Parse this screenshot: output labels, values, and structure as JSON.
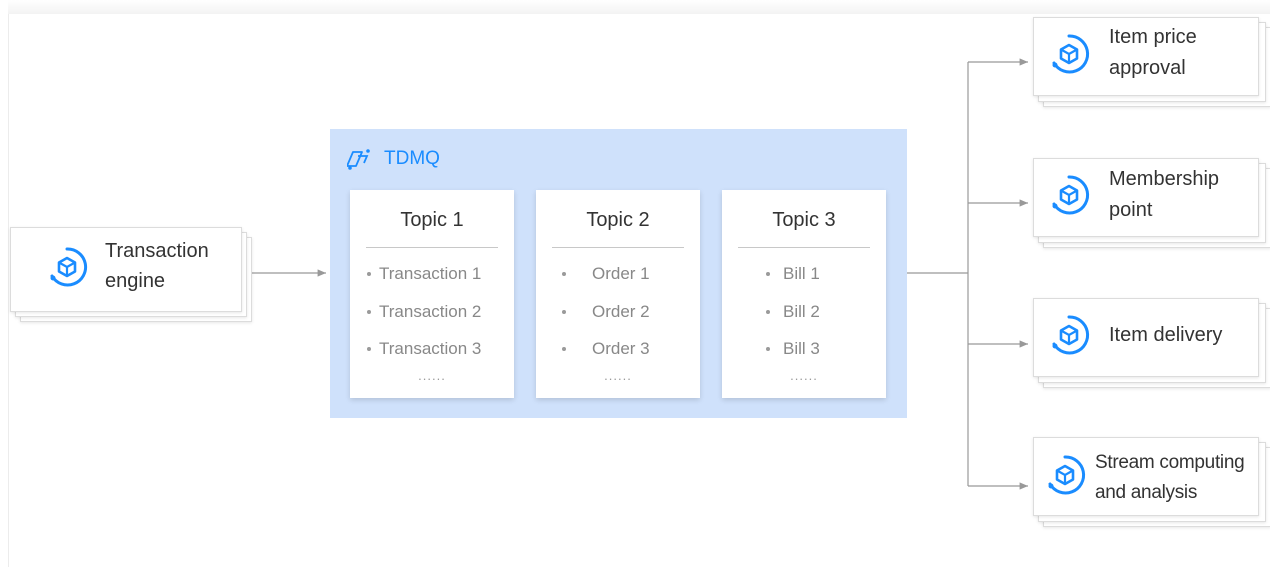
{
  "source": {
    "label_line1": "Transaction",
    "label_line2": "engine",
    "icon": "cube-circle-icon"
  },
  "tdmq": {
    "title": "TDMQ",
    "icon": "tdmq-logo-icon",
    "topics": [
      {
        "title": "Topic 1",
        "items": [
          "Transaction 1",
          "Transaction 2",
          "Transaction 3"
        ],
        "more": "......"
      },
      {
        "title": "Topic 2",
        "items": [
          "Order 1",
          "Order 2",
          "Order 3"
        ],
        "more": "......"
      },
      {
        "title": "Topic 3",
        "items": [
          "Bill 1",
          "Bill 2",
          "Bill 3"
        ],
        "more": "......"
      }
    ]
  },
  "consumers": [
    {
      "line1": "Item price",
      "line2": "approval",
      "icon": "cube-circle-icon"
    },
    {
      "line1": "Membership",
      "line2": "point",
      "icon": "cube-circle-icon"
    },
    {
      "line1": "Item delivery",
      "line2": "",
      "icon": "cube-circle-icon"
    },
    {
      "line1": "Stream computing",
      "line2": "and analysis",
      "icon": "cube-circle-icon"
    }
  ],
  "colors": {
    "accent": "#1a8cff",
    "panel": "#cfe1fb",
    "line": "#999999",
    "text": "#333333",
    "muted": "#888888"
  }
}
